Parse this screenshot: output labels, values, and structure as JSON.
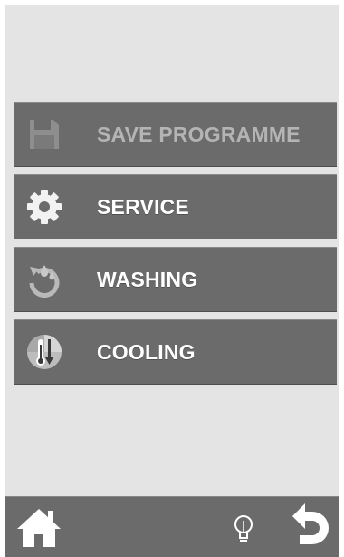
{
  "menu": {
    "items": [
      {
        "label": "SAVE PROGRAMME",
        "icon": "floppy-disk-icon",
        "enabled": false
      },
      {
        "label": "SERVICE",
        "icon": "gear-icon",
        "enabled": true
      },
      {
        "label": "WASHING",
        "icon": "washing-cycle-icon",
        "enabled": true
      },
      {
        "label": "COOLING",
        "icon": "thermometer-cooling-icon",
        "enabled": true
      }
    ]
  },
  "footer": {
    "home_icon": "home-icon",
    "info_icon": "lightbulb-icon",
    "back_icon": "back-arrow-icon"
  },
  "colors": {
    "background": "#e4e4e4",
    "button": "#6b6b6b",
    "label": "#ffffff",
    "disabled_label": "#b4b4b4"
  }
}
